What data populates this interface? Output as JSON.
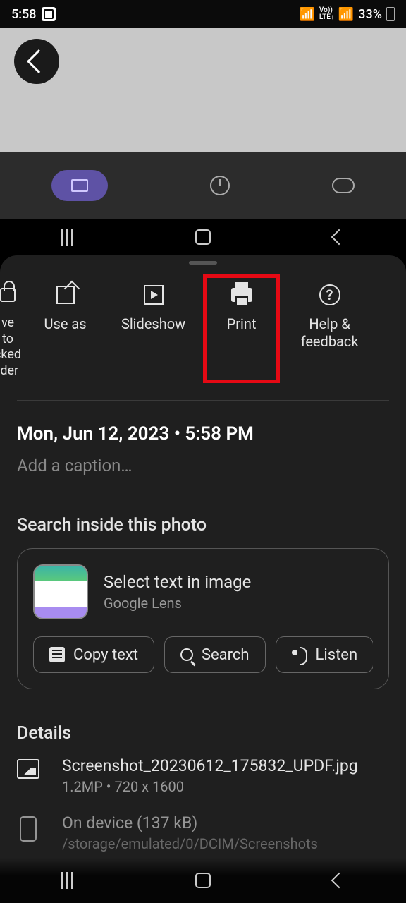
{
  "status": {
    "time": "5:58",
    "battery": "33%",
    "network_icons": "wifi volte signal signal"
  },
  "tabs": {
    "active": "folder"
  },
  "actions": {
    "locked": "ve to\ncked\nlder",
    "use_as": "Use as",
    "slideshow": "Slideshow",
    "print": "Print",
    "help": "Help & feedback"
  },
  "meta": {
    "datetime": "Mon, Jun 12, 2023  •  5:58 PM",
    "caption_placeholder": "Add a caption…"
  },
  "lens": {
    "heading": "Search inside this photo",
    "title": "Select text in image",
    "provider": "Google Lens",
    "chips": {
      "copy": "Copy text",
      "search": "Search",
      "listen": "Listen",
      "translate_partial": "✕"
    }
  },
  "details": {
    "heading": "Details",
    "file": {
      "name": "Screenshot_20230612_175832_UPDF.jpg",
      "sub": "1.2MP   •   720 x 1600"
    },
    "device": {
      "name": "On device (137 kB)",
      "sub": "/storage/emulated/0/DCIM/Screenshots"
    }
  }
}
